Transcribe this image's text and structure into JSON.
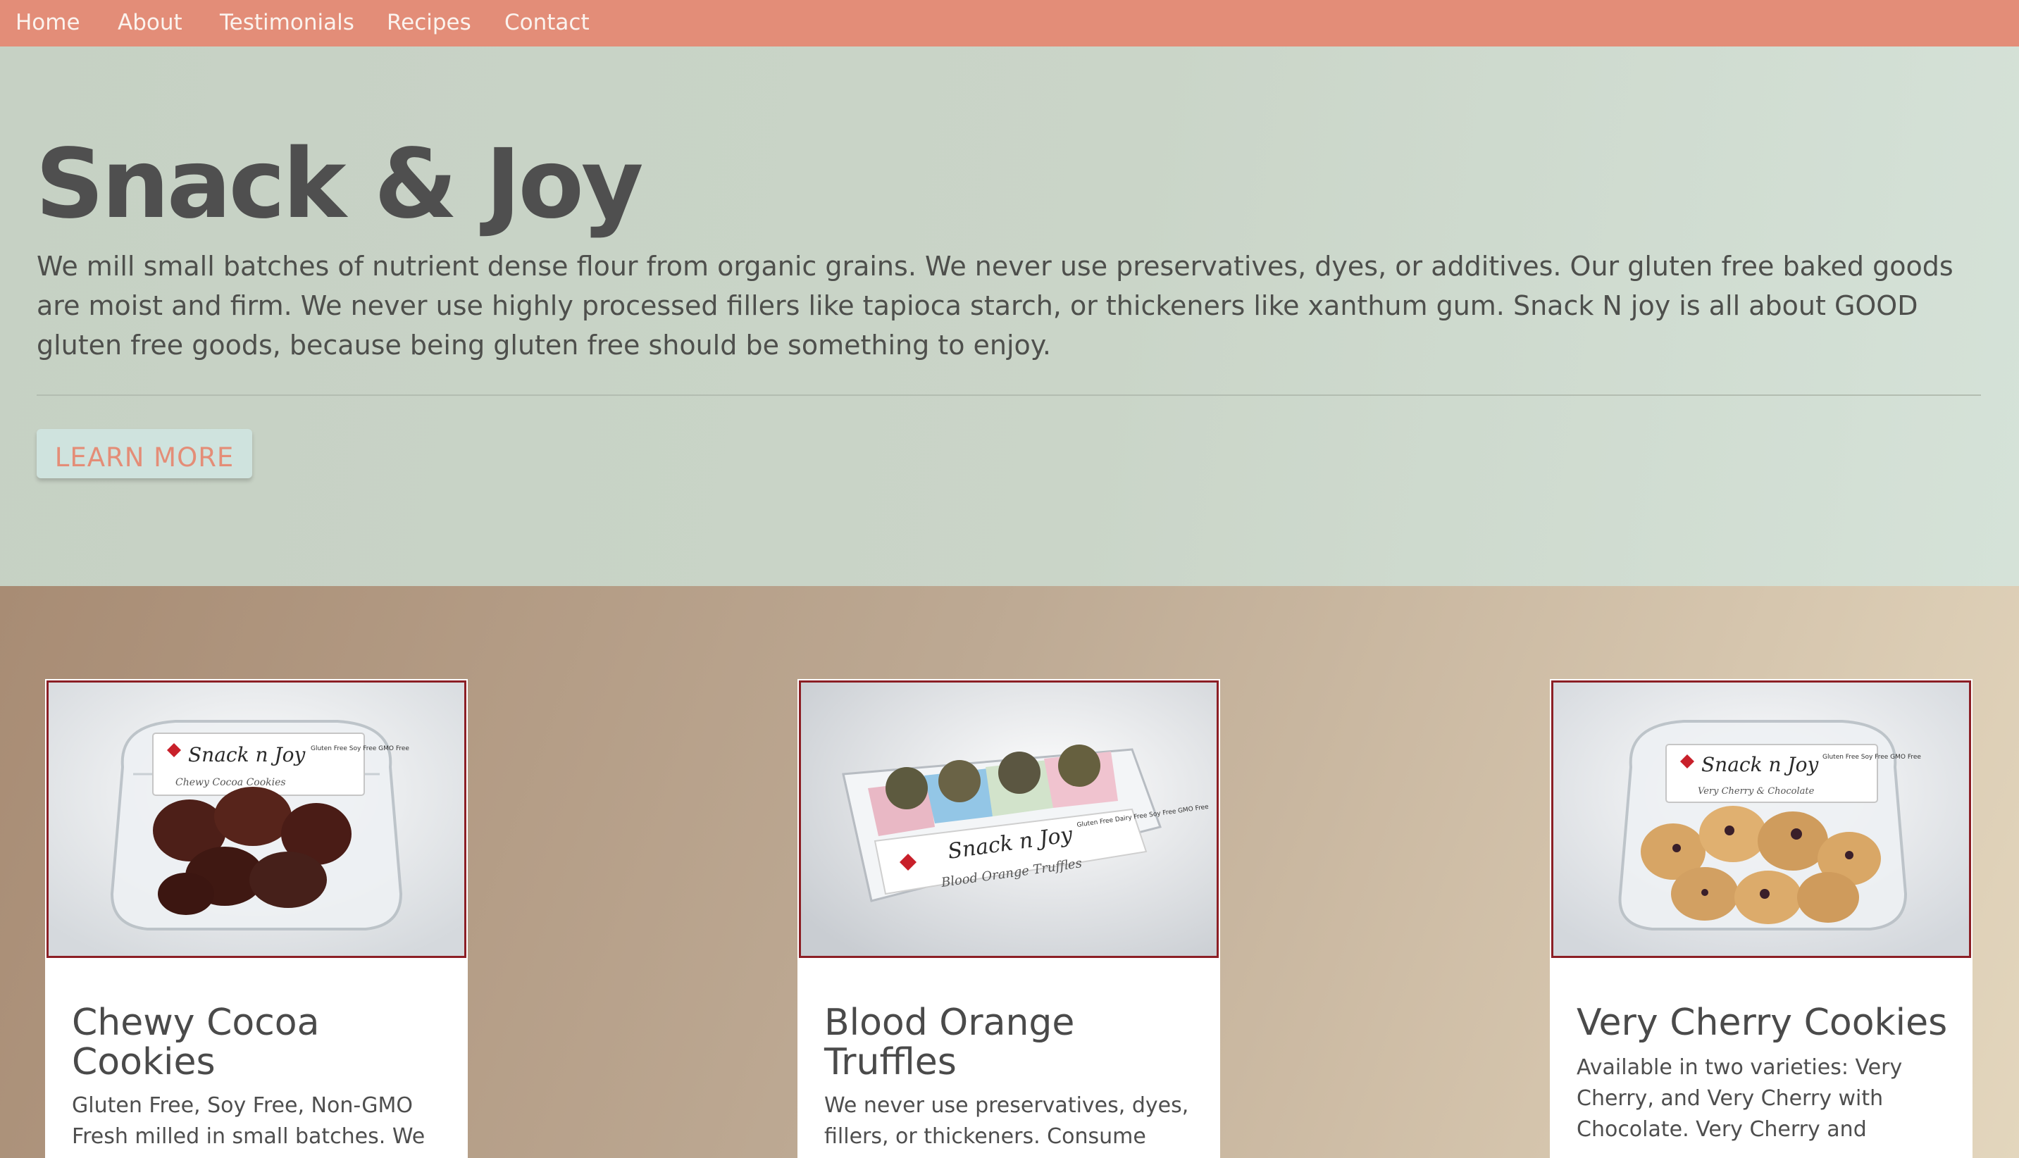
{
  "nav": {
    "items": [
      {
        "label": "Home"
      },
      {
        "label": "About"
      },
      {
        "label": "Testimonials"
      },
      {
        "label": "Recipes"
      },
      {
        "label": "Contact"
      }
    ]
  },
  "hero": {
    "title": "Snack & Joy",
    "text": "We mill small batches of nutrient dense flour from organic grains. We never use preservatives, dyes, or additives. Our gluten free baked goods are moist and firm. We never use highly processed fillers like tapioca starch, or thickeners like xanthum gum. Snack N joy is all about GOOD gluten free goods, because being gluten free should be something to enjoy.",
    "button_label": "LEARN MORE"
  },
  "products": [
    {
      "title": "Chewy Cocoa Cookies",
      "description": "Gluten Free, Soy Free, Non-GMO Fresh milled in small batches. We",
      "label_brand": "Snack n Joy",
      "label_name": "Chewy Cocoa Cookies",
      "label_claims": "Gluten Free Soy Free GMO Free"
    },
    {
      "title": "Blood Orange Truffles",
      "description": "We never use preservatives, dyes, fillers, or thickeners. Consume",
      "label_brand": "Snack n Joy",
      "label_name": "Blood Orange Truffles",
      "label_claims": "Gluten Free Dairy Free Soy Free GMO Free"
    },
    {
      "title": "Very Cherry Cookies",
      "description": "Available in two varieties: Very Cherry, and Very Cherry with Chocolate. Very Cherry and",
      "label_brand": "Snack n Joy",
      "label_name": "Very Cherry & Chocolate",
      "label_claims": "Gluten Free Soy Free GMO Free"
    }
  ],
  "colors": {
    "nav_bg": "#e38d78",
    "hero_bg": "#cad5c8",
    "accent": "#e48d77",
    "image_border": "#8c1f25"
  }
}
